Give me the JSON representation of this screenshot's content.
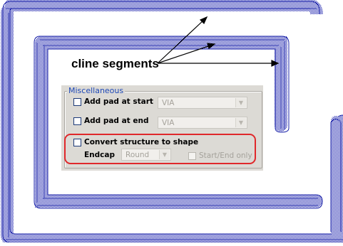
{
  "diagram": {
    "annotation_label": "cline segments"
  },
  "panel": {
    "group_title": "Miscellaneous",
    "add_pad_start": {
      "label": "Add pad at start",
      "value": "VIA",
      "checked": false
    },
    "add_pad_end": {
      "label": "Add pad at end",
      "value": "VIA",
      "checked": false
    },
    "convert_structure": {
      "label": "Convert structure to shape",
      "checked": false
    },
    "endcap": {
      "label": "Endcap",
      "value": "Round"
    },
    "start_end_only": {
      "label": "Start/End only",
      "checked": false
    }
  },
  "colors": {
    "cline_stroke": "#1a22a8",
    "highlight_border": "#e0282b",
    "group_title": "#1f49b8",
    "panel_bg": "#dcdad5"
  },
  "icons": {
    "combo_arrow": "chevron-down-icon"
  }
}
